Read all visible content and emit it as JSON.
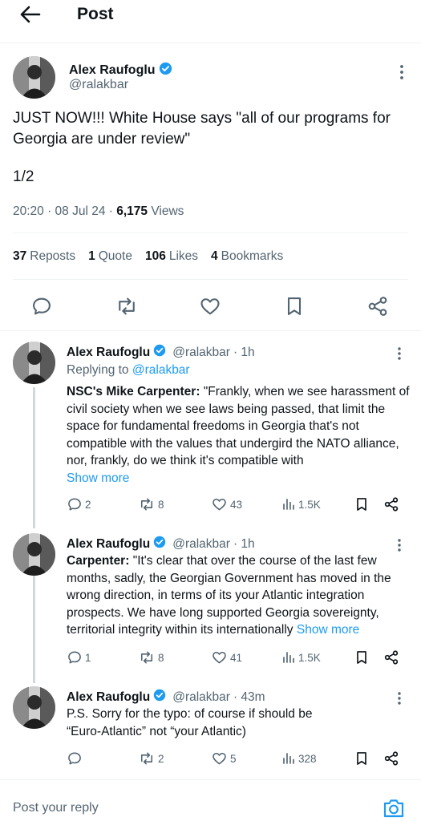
{
  "header": {
    "title": "Post"
  },
  "main_post": {
    "author_name": "Alex Raufoglu",
    "handle": "@ralakbar",
    "text": "JUST NOW!!!  White House says \"all of our programs for Georgia are under review\"",
    "thread_count": "1/2",
    "time": "20:20 · 08 Jul 24 · ",
    "views_count": "6,175",
    "views_label": " Views",
    "stats": {
      "reposts_count": "37",
      "reposts_label": "Reposts",
      "quotes_count": "1",
      "quotes_label": "Quote",
      "likes_count": "106",
      "likes_label": "Likes",
      "bookmarks_count": "4",
      "bookmarks_label": "Bookmarks"
    }
  },
  "replies": [
    {
      "author_name": "Alex Raufoglu",
      "handle": "@ralakbar",
      "time": "· 1h",
      "replying_label": "Replying to ",
      "replying_handle": "@ralakbar",
      "lead": "NSC's Mike Carpenter:",
      "text": " \"Frankly, when we see harassment of civil society when we see laws being passed, that limit the space for fundamental freedoms in Georgia that's not compatible with the values that undergird the NATO alliance, nor, frankly, do we think it's compatible with",
      "show_more": "Show more",
      "replies": "2",
      "reposts": "8",
      "likes": "43",
      "views": "1.5K"
    },
    {
      "author_name": "Alex Raufoglu",
      "handle": "@ralakbar",
      "time": "· 1h",
      "lead": "Carpenter:",
      "text": "  \"It's clear that over the course of the last few months, sadly, the Georgian Government has moved in the wrong direction, in terms of its your Atlantic integration prospects. We have long supported Georgia sovereignty, territorial integrity within its internationally",
      "show_more": "Show more",
      "replies": "1",
      "reposts": "8",
      "likes": "41",
      "views": "1.5K"
    },
    {
      "author_name": "Alex Raufoglu",
      "handle": "@ralakbar",
      "time": "· 43m",
      "text": "P.S. Sorry for the typo: of course if should be “Euro-Atlantic” not “your Atlantic)",
      "replies": "",
      "reposts": "2",
      "likes": "5",
      "views": "328"
    }
  ],
  "composer": {
    "placeholder": "Post your reply"
  },
  "colors": {
    "accent": "#1d9bf0",
    "muted": "#536471",
    "text": "#0f1419",
    "divider": "#eff3f4"
  }
}
